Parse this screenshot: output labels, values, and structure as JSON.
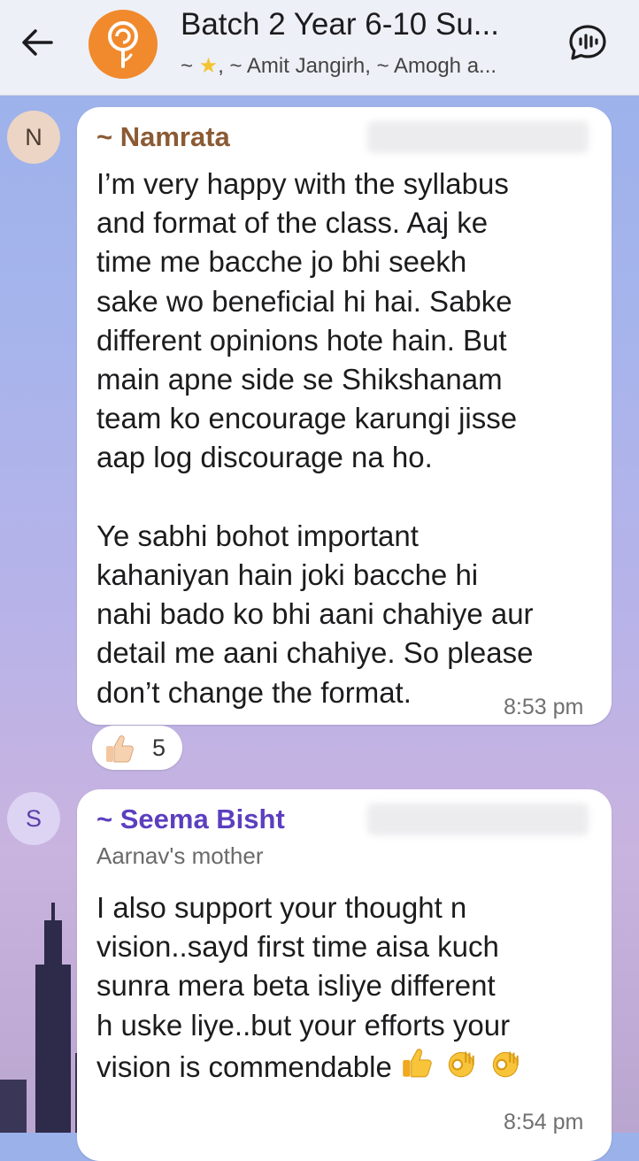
{
  "header": {
    "title": "Batch 2 Year 6-10 Su...",
    "subtitle_prefix": "~ ",
    "subtitle_rest": ", ~ Amit Jangirh, ~ Amogh a..."
  },
  "messages": [
    {
      "avatar_letter": "N",
      "sender": "~ Namrata",
      "text": "I’m very happy with the syllabus\nand format of the class. Aaj ke\ntime me bacche jo bhi seekh\nsake wo beneficial hi hai. Sabke\ndifferent opinions hote hain. But\nmain apne side se Shikshanam\nteam ko encourage karungi jisse\naap log discourage na ho.\n\nYe sabhi bohot important\nkahaniyan hain joki bacche hi\nnahi bado ko bhi aani chahiye aur\ndetail me aani chahiye. So please\ndon’t change the format.",
      "time": "8:53 pm",
      "reaction": {
        "emoji": "thumbs-up-icon",
        "count": "5"
      }
    },
    {
      "avatar_letter": "S",
      "sender": "~ Seema Bisht",
      "role": "Aarnav's mother",
      "text": "I also support your thought n\nvision..sayd first time aisa kuch\nsunra mera beta isliye different\nh uske liye..but your efforts your\nvision is commendable",
      "time": "8:54 pm"
    }
  ],
  "colors": {
    "header_bg": "#eef0f7",
    "group_avatar": "#f08a2c",
    "name_namrata": "#8b5a33",
    "name_seema": "#5c3fbf"
  }
}
